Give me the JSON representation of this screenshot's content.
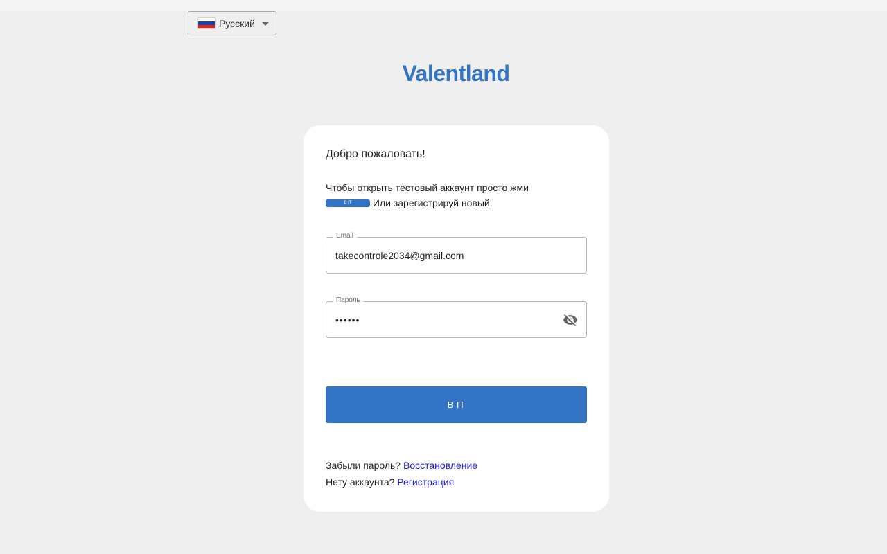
{
  "colors": {
    "accent": "#3273c4",
    "link": "#1a1adc",
    "background": "#efefef"
  },
  "language_select": {
    "label": "Русский",
    "flag_icon": "russia-flag-icon"
  },
  "logo": {
    "text": "Valentland"
  },
  "card": {
    "welcome": "Добро пожаловать!",
    "intro_text": "Чтобы открыть тестовый аккаунт просто жми",
    "intro_button_label": "В IT",
    "intro_text_after": "Или зарегистрируй новый.",
    "email": {
      "label": "Email",
      "value": "takecontrole2034@gmail.com"
    },
    "password": {
      "label": "Пароль",
      "value": "••••••",
      "toggle_icon": "eye-off-icon"
    },
    "submit_label": "В IT",
    "forgot_text": "Забыли пароль?",
    "forgot_link": "Восстановление",
    "noaccount_text": "Нету аккаунта?",
    "register_link": "Регистрация"
  }
}
